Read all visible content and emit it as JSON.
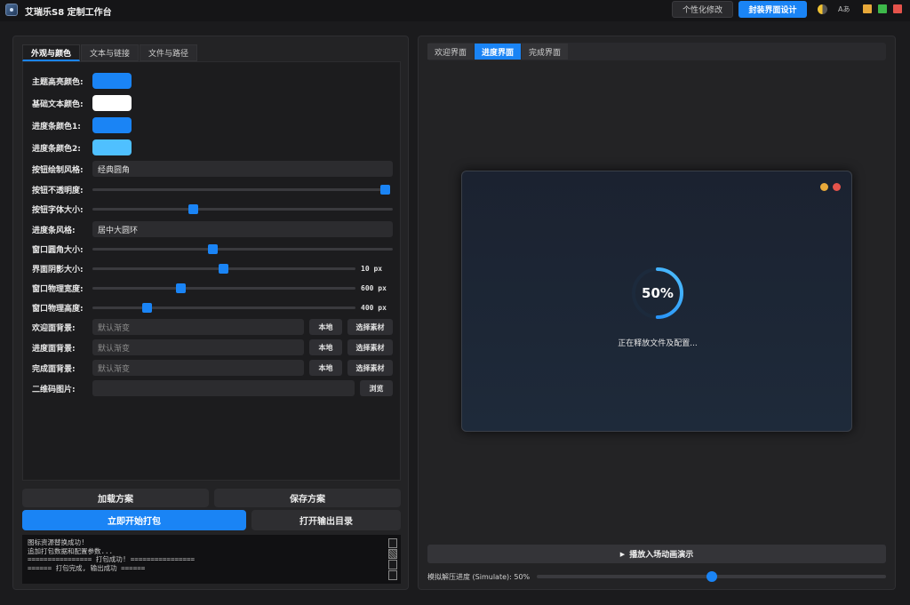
{
  "titlebar": {
    "title": "艾瑞乐S8 定制工作台",
    "personal_btn": "个性化修改",
    "pack_btn": "封装界面设计",
    "theme_icon": "half-moon-icon",
    "lang_icon": "translate-icon",
    "lang_text": "Aあ",
    "window_colors": {
      "minimize": "#e8a93a",
      "maximize": "#3db84a",
      "close": "#e5534b"
    }
  },
  "left": {
    "tabs": [
      "外观与颜色",
      "文本与链接",
      "文件与路径"
    ],
    "active_tab": 0,
    "colors": [
      {
        "label": "主题高亮颜色:",
        "value": "#1a84f5"
      },
      {
        "label": "基础文本颜色:",
        "value": "#ffffff"
      },
      {
        "label": "进度条颜色1:",
        "value": "#1a84f5"
      },
      {
        "label": "进度条颜色2:",
        "value": "#4fc0ff"
      }
    ],
    "button_style": {
      "label": "按钮绘制风格:",
      "value": "经典圆角"
    },
    "opacity": {
      "label": "按钮不透明度:",
      "level": 1.0
    },
    "font_size": {
      "label": "按钮字体大小:",
      "level": 0.34
    },
    "progress_style": {
      "label": "进度条风格:",
      "value": "居中大圆环"
    },
    "window_radius": {
      "label": "窗口圆角大小:",
      "level": 0.4
    },
    "shadow": {
      "label": "界面阴影大小:",
      "level": 0.5,
      "value_text": "10 px"
    },
    "width": {
      "label": "窗口物理宽度:",
      "level": 0.33,
      "value_text": "600 px"
    },
    "height": {
      "label": "窗口物理高度:",
      "level": 0.21,
      "value_text": "400 px"
    },
    "backgrounds": [
      {
        "label": "欢迎面背景:",
        "placeholder": "默认渐变",
        "local_btn": "本地",
        "pick_btn": "选择素材"
      },
      {
        "label": "进度面背景:",
        "placeholder": "默认渐变",
        "local_btn": "本地",
        "pick_btn": "选择素材"
      },
      {
        "label": "完成面背景:",
        "placeholder": "默认渐变",
        "local_btn": "本地",
        "pick_btn": "选择素材"
      }
    ],
    "qr": {
      "label": "二维码图片:",
      "value": "",
      "browse_btn": "浏览"
    },
    "load_btn": "加载方案",
    "save_btn": "保存方案",
    "start_btn": "立即开始打包",
    "open_btn": "打开输出目录",
    "log": [
      "图标资源替换成功!",
      "追加打包数据和配置参数...",
      "================ 打包成功! ================",
      "====== 打包完成, 输出成功 ======"
    ]
  },
  "right": {
    "tabs": [
      "欢迎界面",
      "进度界面",
      "完成界面"
    ],
    "active_tab": 1,
    "preview": {
      "percent_text": "50%",
      "progress": 0.5,
      "status": "正在释放文件及配置..."
    },
    "play_btn": "播放入场动画演示",
    "simulate": {
      "label": "模拟解压进度 (Simulate): 50%",
      "level": 0.5
    }
  }
}
